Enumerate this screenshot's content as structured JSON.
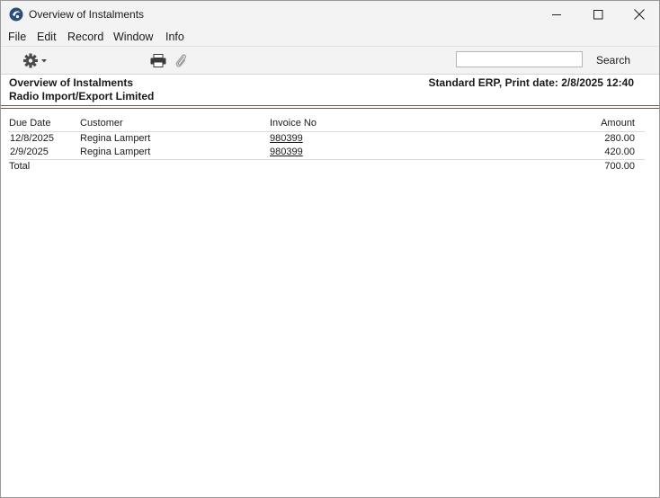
{
  "window": {
    "title": "Overview of Instalments"
  },
  "menu": {
    "items": [
      "File",
      "Edit",
      "Record",
      "Window",
      "Info"
    ]
  },
  "toolbar": {
    "search_value": "",
    "search_label": "Search"
  },
  "report_header": {
    "title": "Overview of Instalments",
    "company": "Radio Import/Export Limited",
    "print_info": "Standard ERP, Print date: 2/8/2025 12:40"
  },
  "table": {
    "columns": [
      "Due Date",
      "Customer",
      "Invoice No",
      "Amount"
    ],
    "rows": [
      {
        "due_date": "12/8/2025",
        "customer": "Regina Lampert",
        "invoice_no": "980399",
        "amount": "280.00"
      },
      {
        "due_date": "2/9/2025",
        "customer": "Regina Lampert",
        "invoice_no": "980399",
        "amount": "420.00"
      }
    ],
    "total_label": "Total",
    "total_amount": "700.00"
  }
}
